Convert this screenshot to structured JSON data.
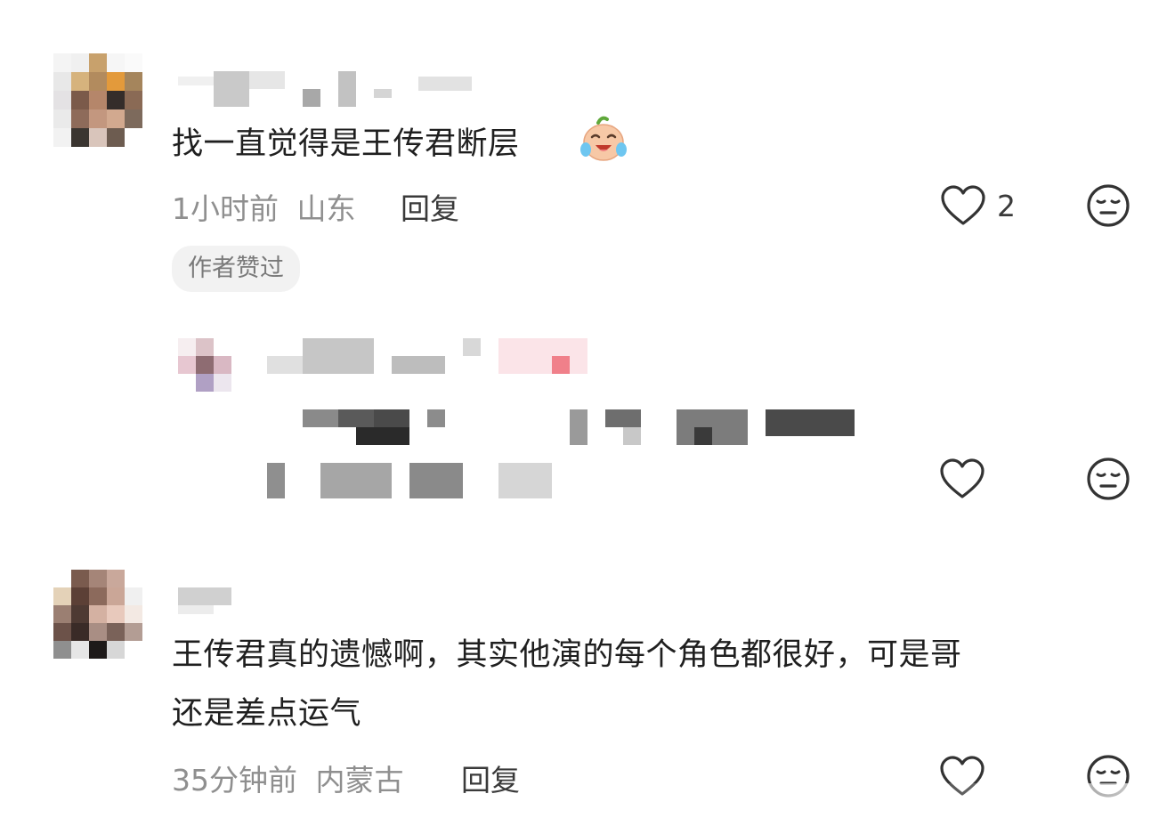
{
  "comments": [
    {
      "text": "找一直觉得是王传君断层",
      "emoji": "cry-laugh-emoji",
      "time": "1小时前",
      "location": "山东",
      "reply_label": "回复",
      "like_count": "2",
      "badge": "作者赞过"
    },
    {
      "text_line1": "王传君真的遗憾啊，其实他演的每个角色都很好，可是哥",
      "text_line2": "还是差点运气",
      "time": "35分钟前",
      "location": "内蒙古",
      "reply_label": "回复"
    }
  ],
  "icons": {
    "like": "heart-outline-icon",
    "dislike": "neutral-face-icon"
  },
  "colors": {
    "meta_text": "#8f8f8f",
    "primary_text": "#1f1f1f",
    "badge_bg": "#f2f2f2"
  }
}
